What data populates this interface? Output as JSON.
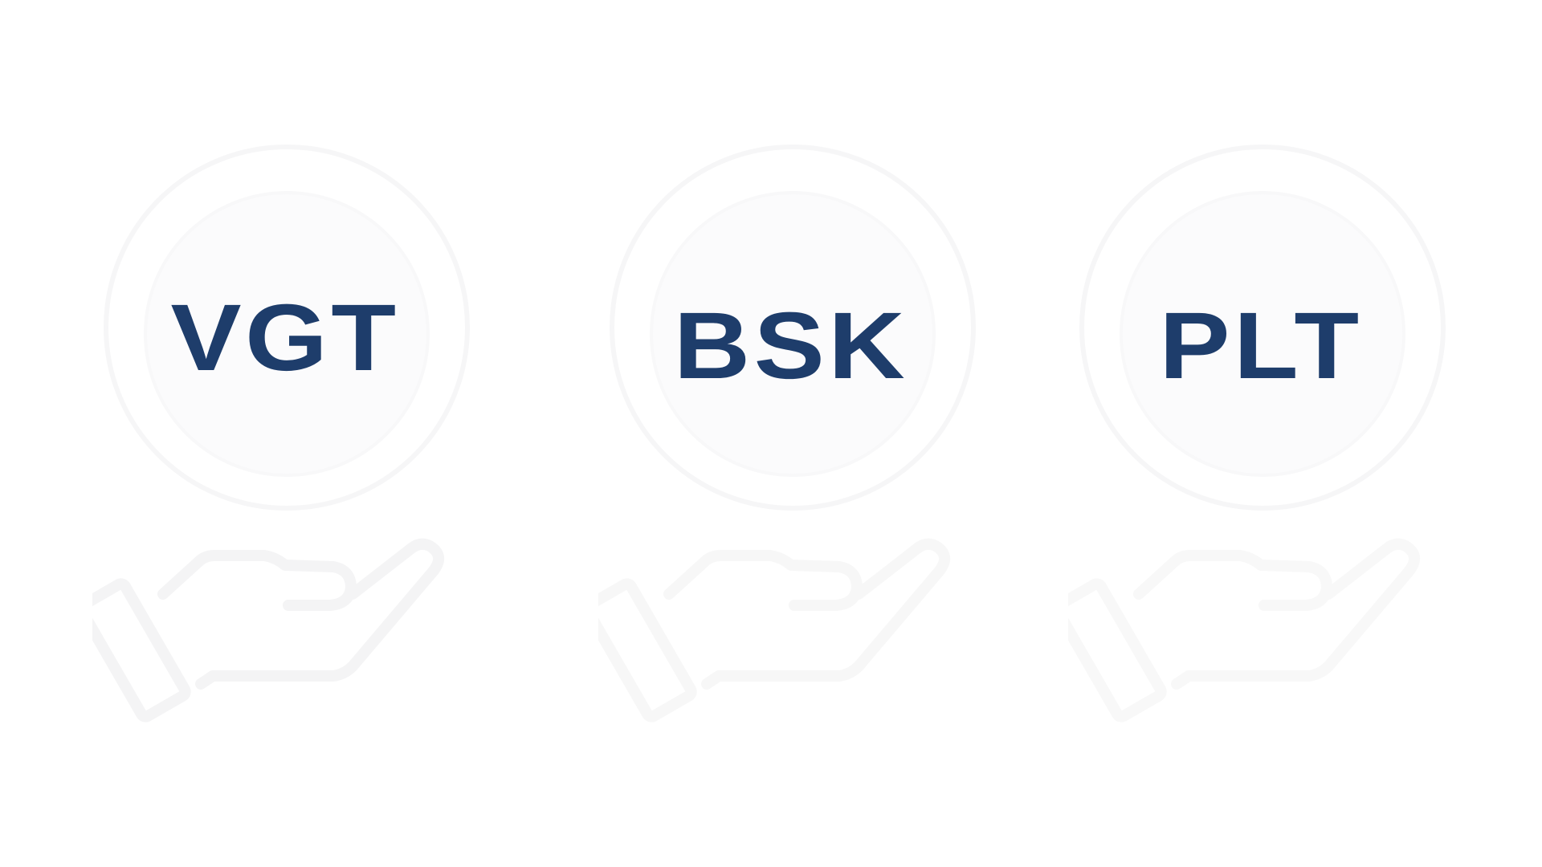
{
  "colors": {
    "text": "#1e3d6b",
    "ring": "#f6f6f7",
    "hand_stroke": "#f5f5f5"
  },
  "logos": [
    {
      "label": "VGT",
      "icon": "hand-holding-circle-icon"
    },
    {
      "label": "BSK",
      "icon": "hand-holding-circle-icon"
    },
    {
      "label": "PLT",
      "icon": "hand-holding-circle-icon"
    }
  ]
}
